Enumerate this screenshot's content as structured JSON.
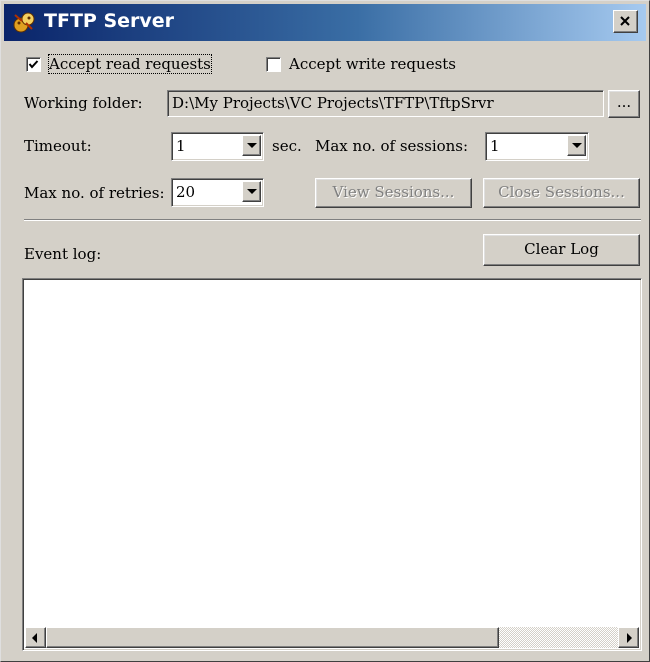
{
  "window": {
    "title": "TFTP Server",
    "close_glyph": "✕"
  },
  "options": {
    "accept_read": {
      "label": "Accept read requests",
      "checked": true
    },
    "accept_write": {
      "label": "Accept write requests",
      "checked": false
    }
  },
  "folder": {
    "label": "Working folder:",
    "value": "D:\\My Projects\\VC Projects\\TFTP\\TftpSrvr",
    "browse_label": "..."
  },
  "timeout": {
    "label": "Timeout:",
    "value": "1",
    "unit": "sec."
  },
  "sessions": {
    "label": "Max no. of sessions:",
    "value": "1"
  },
  "retries": {
    "label": "Max no. of retries:",
    "value": "20"
  },
  "buttons": {
    "view_sessions": "View Sessions...",
    "close_sessions": "Close Sessions...",
    "clear_log": "Clear Log"
  },
  "event_log": {
    "label": "Event log:",
    "entries": []
  },
  "icons": {
    "app": "tftp-app-icon",
    "close": "close-icon",
    "check": "checkmark-icon",
    "dropdown": "chevron-down-icon",
    "scroll_left": "arrow-left-icon",
    "scroll_right": "arrow-right-icon"
  },
  "colors": {
    "title_start": "#0a246a",
    "title_end": "#a6caf0",
    "face": "#d4d0c8"
  }
}
